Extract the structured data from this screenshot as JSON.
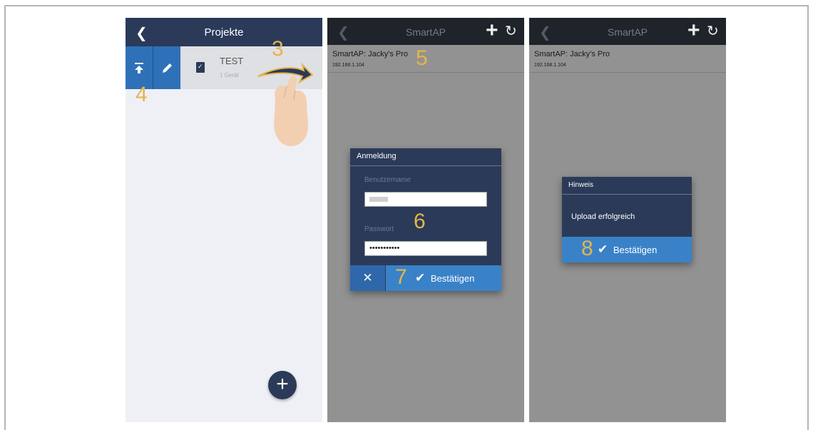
{
  "phone1": {
    "back_glyph": "‹",
    "title": "Projekte",
    "project": {
      "name": "TEST",
      "subtitle": "1 Gerät"
    },
    "add_glyph": "+"
  },
  "phone2": {
    "title": "SmartAP",
    "device": {
      "name": "SmartAP: Jacky's Pro",
      "ip": "192.168.1.104"
    },
    "login_dialog": {
      "title": "Anmeldung",
      "username_label": "Benutzername",
      "password_label": "Passwort",
      "password_value": "•••••••••••",
      "confirm_label": "Bestätigen"
    }
  },
  "phone3": {
    "title": "SmartAP",
    "device": {
      "name": "SmartAP: Jacky's Pro",
      "ip": "192.168.1.104"
    },
    "hint_dialog": {
      "title": "Hinweis",
      "message": "Upload erfolgreich",
      "confirm_label": "Bestätigen"
    }
  },
  "steps": [
    "3",
    "4",
    "5",
    "6",
    "7",
    "8"
  ],
  "colors": {
    "header_dark": "#2b3a58",
    "accent_blue": "#3a82c8",
    "step_number": "#e3b54a"
  },
  "icons": [
    "back-icon",
    "upload-icon",
    "edit-icon",
    "clipboard-icon",
    "swipe-arrow-icon",
    "hand-icon",
    "plus-icon",
    "refresh-icon",
    "close-icon",
    "check-icon"
  ]
}
